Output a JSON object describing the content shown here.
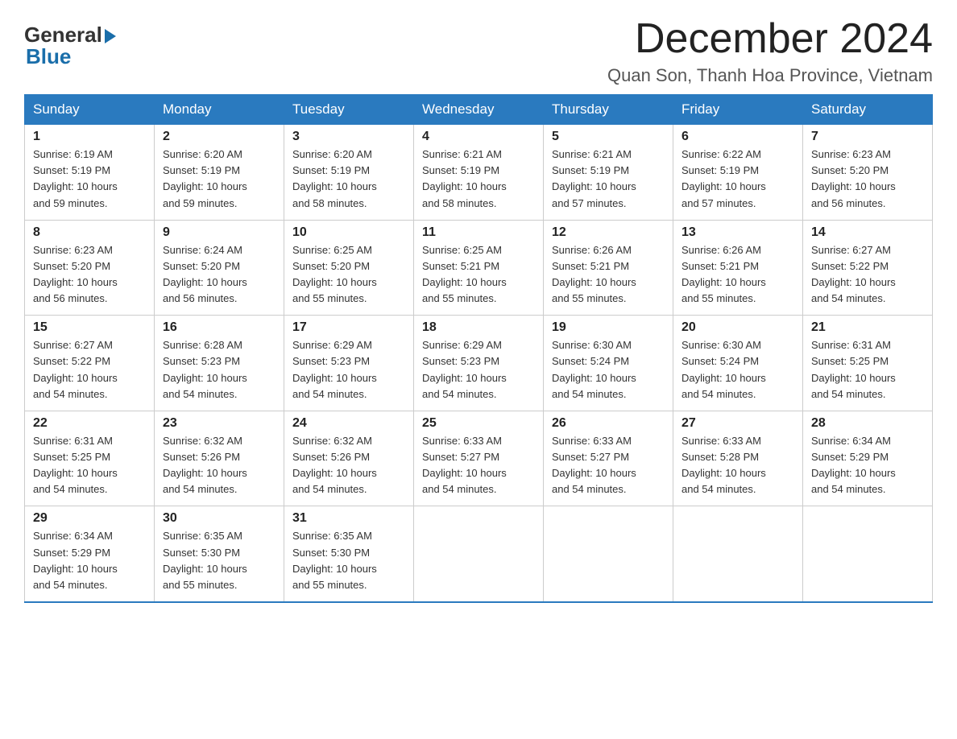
{
  "header": {
    "logo_general": "General",
    "logo_blue": "Blue",
    "month_title": "December 2024",
    "location": "Quan Son, Thanh Hoa Province, Vietnam"
  },
  "days_of_week": [
    "Sunday",
    "Monday",
    "Tuesday",
    "Wednesday",
    "Thursday",
    "Friday",
    "Saturday"
  ],
  "weeks": [
    [
      {
        "day": "1",
        "sunrise": "6:19 AM",
        "sunset": "5:19 PM",
        "daylight": "10 hours and 59 minutes."
      },
      {
        "day": "2",
        "sunrise": "6:20 AM",
        "sunset": "5:19 PM",
        "daylight": "10 hours and 59 minutes."
      },
      {
        "day": "3",
        "sunrise": "6:20 AM",
        "sunset": "5:19 PM",
        "daylight": "10 hours and 58 minutes."
      },
      {
        "day": "4",
        "sunrise": "6:21 AM",
        "sunset": "5:19 PM",
        "daylight": "10 hours and 58 minutes."
      },
      {
        "day": "5",
        "sunrise": "6:21 AM",
        "sunset": "5:19 PM",
        "daylight": "10 hours and 57 minutes."
      },
      {
        "day": "6",
        "sunrise": "6:22 AM",
        "sunset": "5:19 PM",
        "daylight": "10 hours and 57 minutes."
      },
      {
        "day": "7",
        "sunrise": "6:23 AM",
        "sunset": "5:20 PM",
        "daylight": "10 hours and 56 minutes."
      }
    ],
    [
      {
        "day": "8",
        "sunrise": "6:23 AM",
        "sunset": "5:20 PM",
        "daylight": "10 hours and 56 minutes."
      },
      {
        "day": "9",
        "sunrise": "6:24 AM",
        "sunset": "5:20 PM",
        "daylight": "10 hours and 56 minutes."
      },
      {
        "day": "10",
        "sunrise": "6:25 AM",
        "sunset": "5:20 PM",
        "daylight": "10 hours and 55 minutes."
      },
      {
        "day": "11",
        "sunrise": "6:25 AM",
        "sunset": "5:21 PM",
        "daylight": "10 hours and 55 minutes."
      },
      {
        "day": "12",
        "sunrise": "6:26 AM",
        "sunset": "5:21 PM",
        "daylight": "10 hours and 55 minutes."
      },
      {
        "day": "13",
        "sunrise": "6:26 AM",
        "sunset": "5:21 PM",
        "daylight": "10 hours and 55 minutes."
      },
      {
        "day": "14",
        "sunrise": "6:27 AM",
        "sunset": "5:22 PM",
        "daylight": "10 hours and 54 minutes."
      }
    ],
    [
      {
        "day": "15",
        "sunrise": "6:27 AM",
        "sunset": "5:22 PM",
        "daylight": "10 hours and 54 minutes."
      },
      {
        "day": "16",
        "sunrise": "6:28 AM",
        "sunset": "5:23 PM",
        "daylight": "10 hours and 54 minutes."
      },
      {
        "day": "17",
        "sunrise": "6:29 AM",
        "sunset": "5:23 PM",
        "daylight": "10 hours and 54 minutes."
      },
      {
        "day": "18",
        "sunrise": "6:29 AM",
        "sunset": "5:23 PM",
        "daylight": "10 hours and 54 minutes."
      },
      {
        "day": "19",
        "sunrise": "6:30 AM",
        "sunset": "5:24 PM",
        "daylight": "10 hours and 54 minutes."
      },
      {
        "day": "20",
        "sunrise": "6:30 AM",
        "sunset": "5:24 PM",
        "daylight": "10 hours and 54 minutes."
      },
      {
        "day": "21",
        "sunrise": "6:31 AM",
        "sunset": "5:25 PM",
        "daylight": "10 hours and 54 minutes."
      }
    ],
    [
      {
        "day": "22",
        "sunrise": "6:31 AM",
        "sunset": "5:25 PM",
        "daylight": "10 hours and 54 minutes."
      },
      {
        "day": "23",
        "sunrise": "6:32 AM",
        "sunset": "5:26 PM",
        "daylight": "10 hours and 54 minutes."
      },
      {
        "day": "24",
        "sunrise": "6:32 AM",
        "sunset": "5:26 PM",
        "daylight": "10 hours and 54 minutes."
      },
      {
        "day": "25",
        "sunrise": "6:33 AM",
        "sunset": "5:27 PM",
        "daylight": "10 hours and 54 minutes."
      },
      {
        "day": "26",
        "sunrise": "6:33 AM",
        "sunset": "5:27 PM",
        "daylight": "10 hours and 54 minutes."
      },
      {
        "day": "27",
        "sunrise": "6:33 AM",
        "sunset": "5:28 PM",
        "daylight": "10 hours and 54 minutes."
      },
      {
        "day": "28",
        "sunrise": "6:34 AM",
        "sunset": "5:29 PM",
        "daylight": "10 hours and 54 minutes."
      }
    ],
    [
      {
        "day": "29",
        "sunrise": "6:34 AM",
        "sunset": "5:29 PM",
        "daylight": "10 hours and 54 minutes."
      },
      {
        "day": "30",
        "sunrise": "6:35 AM",
        "sunset": "5:30 PM",
        "daylight": "10 hours and 55 minutes."
      },
      {
        "day": "31",
        "sunrise": "6:35 AM",
        "sunset": "5:30 PM",
        "daylight": "10 hours and 55 minutes."
      },
      null,
      null,
      null,
      null
    ]
  ],
  "labels": {
    "sunrise": "Sunrise:",
    "sunset": "Sunset:",
    "daylight": "Daylight:"
  }
}
